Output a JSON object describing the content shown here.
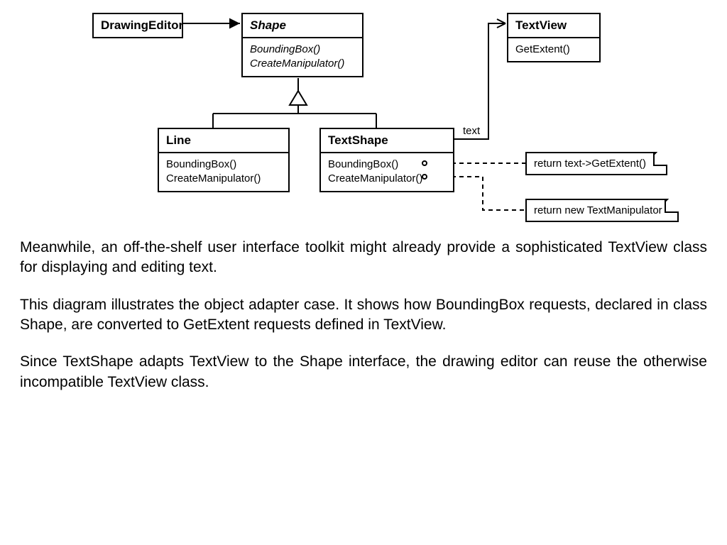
{
  "classes": {
    "drawingEditor": {
      "name": "DrawingEditor"
    },
    "shape": {
      "name": "Shape",
      "methods": [
        "BoundingBox()",
        "CreateManipulator()"
      ]
    },
    "textView": {
      "name": "TextView",
      "methods": [
        "GetExtent()"
      ]
    },
    "line": {
      "name": "Line",
      "methods": [
        "BoundingBox()",
        "CreateManipulator()"
      ]
    },
    "textShape": {
      "name": "TextShape",
      "methods": [
        "BoundingBox()",
        "CreateManipulator()"
      ]
    }
  },
  "associationLabel": "text",
  "notes": {
    "getExtent": "return text->GetExtent()",
    "newManipulator": "return new TextManipulator"
  },
  "paragraphs": [
    "Meanwhile, an off-the-shelf user interface toolkit might already provide a sophisticated TextView class for displaying and editing text.",
    "This diagram illustrates the object adapter case. It shows how BoundingBox requests, declared in class Shape, are converted to GetExtent requests defined in TextView.",
    "Since TextShape adapts TextView to the Shape interface, the drawing editor can reuse the otherwise incompatible TextView class."
  ]
}
